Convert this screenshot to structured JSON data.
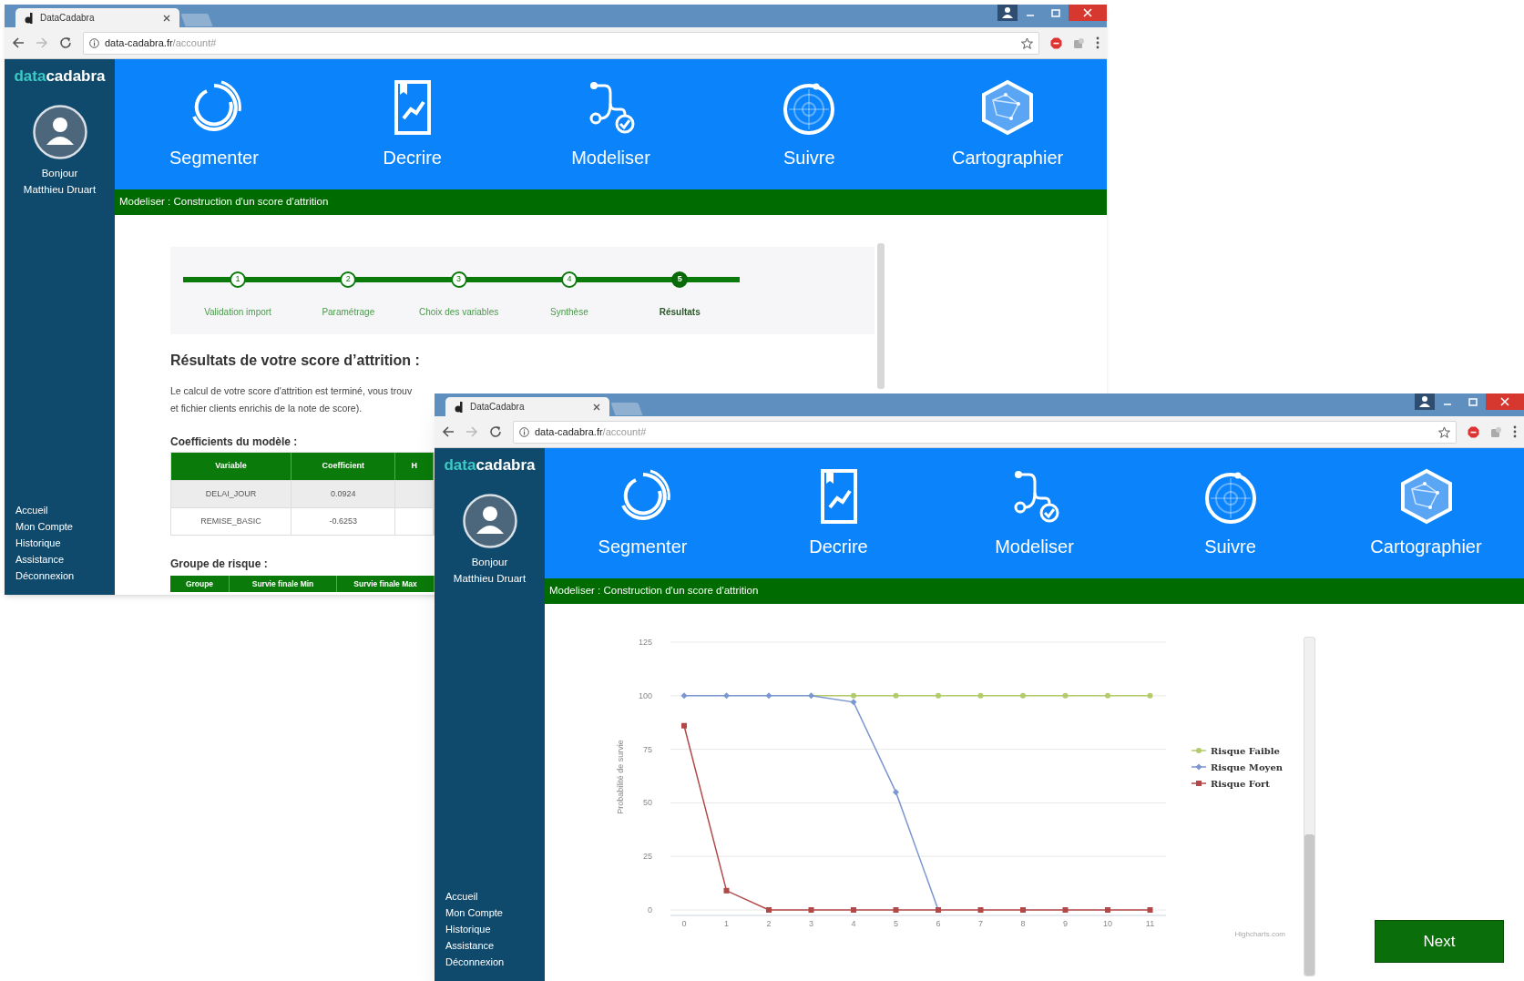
{
  "windows": [
    {
      "kind": "results",
      "tab_title": "DataCadabra",
      "url_host": "data-cadabra.fr",
      "url_path": "/account#",
      "logo_parts": [
        "data",
        "cadabra"
      ],
      "greeting": "Bonjour",
      "user_name": "Matthieu Druart",
      "nav": [
        {
          "label": "Segmenter"
        },
        {
          "label": "Decrire"
        },
        {
          "label": "Modeliser"
        },
        {
          "label": "Suivre"
        },
        {
          "label": "Cartographier"
        }
      ],
      "breadcrumb": "Modeliser : Construction d'un score d'attrition",
      "sidebar_links": [
        "Accueil",
        "Mon Compte",
        "Historique",
        "Assistance",
        "Déconnexion"
      ],
      "steps": [
        {
          "number": "1",
          "label": "Validation import",
          "selected": false
        },
        {
          "number": "2",
          "label": "Paramétrage",
          "selected": false
        },
        {
          "number": "3",
          "label": "Choix des variables",
          "selected": false
        },
        {
          "number": "4",
          "label": "Synthèse",
          "selected": false
        },
        {
          "number": "5",
          "label": "Résultats",
          "selected": true
        }
      ],
      "heading": "Résultats de votre score d’attrition :",
      "paragraph_lines": [
        "Le calcul de votre score d'attrition est terminé, vous trouv",
        "et fichier clients enrichis de la note de score)."
      ],
      "coefficients": {
        "title": "Coefficients du modèle :",
        "columns": [
          "Variable",
          "Coefficient",
          "H"
        ],
        "rows": [
          [
            "DELAI_JOUR",
            "0.0924"
          ],
          [
            "REMISE_BASIC",
            "-0.6253"
          ]
        ]
      },
      "risk_groups": {
        "title": "Groupe de risque :",
        "columns": [
          "Groupe",
          "Survie finale Min",
          "Survie finale Max"
        ]
      }
    },
    {
      "kind": "chart",
      "tab_title": "DataCadabra",
      "url_host": "data-cadabra.fr",
      "url_path": "/account#",
      "logo_parts": [
        "data",
        "cadabra"
      ],
      "greeting": "Bonjour",
      "user_name": "Matthieu Druart",
      "nav": [
        {
          "label": "Segmenter"
        },
        {
          "label": "Decrire"
        },
        {
          "label": "Modeliser"
        },
        {
          "label": "Suivre"
        },
        {
          "label": "Cartographier"
        }
      ],
      "breadcrumb": "Modeliser : Construction d'un score d'attrition",
      "sidebar_links": [
        "Accueil",
        "Mon Compte",
        "Historique",
        "Assistance",
        "Déconnexion"
      ],
      "chart_data": {
        "type": "line",
        "grid": true,
        "legend": true,
        "ylabel": "Probabilité de survie",
        "categories": [
          "0",
          "1",
          "2",
          "3",
          "4",
          "5",
          "6",
          "7",
          "8",
          "9",
          "10",
          "11"
        ],
        "ylim": [
          0,
          125
        ],
        "yticks": [
          0,
          25,
          50,
          75,
          100,
          125
        ],
        "series": [
          {
            "name": "Risque Faible",
            "color": "#b3cb6b",
            "marker": "circle",
            "values": [
              null,
              null,
              null,
              100,
              100,
              100,
              100,
              100,
              100,
              100,
              100,
              100
            ]
          },
          {
            "name": "Risque Moyen",
            "color": "#7b97d0",
            "marker": "diamond",
            "values": [
              100,
              100,
              100,
              100,
              97,
              55,
              0,
              null,
              null,
              null,
              null,
              null
            ]
          },
          {
            "name": "Risque Fort",
            "color": "#b24848",
            "marker": "square",
            "values": [
              86,
              9,
              0,
              0,
              0,
              0,
              0,
              0,
              0,
              0,
              0,
              0
            ]
          }
        ]
      },
      "credit": "Highcharts.com",
      "next_button": "Next"
    }
  ]
}
